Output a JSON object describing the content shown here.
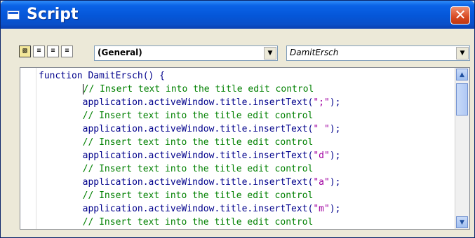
{
  "window": {
    "title": "Script",
    "close_glyph": "✕"
  },
  "toolbar": {
    "buttons": [
      {
        "name": "procedure-view-icon",
        "glyph": "▧"
      },
      {
        "name": "align-left-icon",
        "glyph": "≡"
      },
      {
        "name": "align-center-icon",
        "glyph": "≡"
      },
      {
        "name": "align-right-icon",
        "glyph": "≡"
      }
    ],
    "object_select": {
      "value": "(General)"
    },
    "proc_select": {
      "value": "DamitErsch"
    }
  },
  "editor": {
    "lines": [
      {
        "parts": [
          {
            "t": "kw",
            "v": "function DamitErsch() {"
          }
        ]
      },
      {
        "parts": [
          {
            "t": "cm",
            "v": "// Insert text into the title edit control",
            "indent": "        ",
            "caret": true
          }
        ]
      },
      {
        "parts": [
          {
            "t": "kw",
            "v": "application.activeWindow.title.insertText(",
            "indent": "        "
          },
          {
            "t": "str",
            "v": "\";\""
          },
          {
            "t": "kw",
            "v": ");"
          }
        ]
      },
      {
        "parts": [
          {
            "t": "cm",
            "v": "// Insert text into the title edit control",
            "indent": "        "
          }
        ]
      },
      {
        "parts": [
          {
            "t": "kw",
            "v": "application.activeWindow.title.insertText(",
            "indent": "        "
          },
          {
            "t": "str",
            "v": "\" \""
          },
          {
            "t": "kw",
            "v": ");"
          }
        ]
      },
      {
        "parts": [
          {
            "t": "cm",
            "v": "// Insert text into the title edit control",
            "indent": "        "
          }
        ]
      },
      {
        "parts": [
          {
            "t": "kw",
            "v": "application.activeWindow.title.insertText(",
            "indent": "        "
          },
          {
            "t": "str",
            "v": "\"d\""
          },
          {
            "t": "kw",
            "v": ");"
          }
        ]
      },
      {
        "parts": [
          {
            "t": "cm",
            "v": "// Insert text into the title edit control",
            "indent": "        "
          }
        ]
      },
      {
        "parts": [
          {
            "t": "kw",
            "v": "application.activeWindow.title.insertText(",
            "indent": "        "
          },
          {
            "t": "str",
            "v": "\"a\""
          },
          {
            "t": "kw",
            "v": ");"
          }
        ]
      },
      {
        "parts": [
          {
            "t": "cm",
            "v": "// Insert text into the title edit control",
            "indent": "        "
          }
        ]
      },
      {
        "parts": [
          {
            "t": "kw",
            "v": "application.activeWindow.title.insertText(",
            "indent": "        "
          },
          {
            "t": "str",
            "v": "\"m\""
          },
          {
            "t": "kw",
            "v": ");"
          }
        ]
      },
      {
        "parts": [
          {
            "t": "cm",
            "v": "// Insert text into the title edit control",
            "indent": "        "
          }
        ]
      }
    ],
    "scroll_up_glyph": "▲",
    "scroll_down_glyph": "▼"
  }
}
